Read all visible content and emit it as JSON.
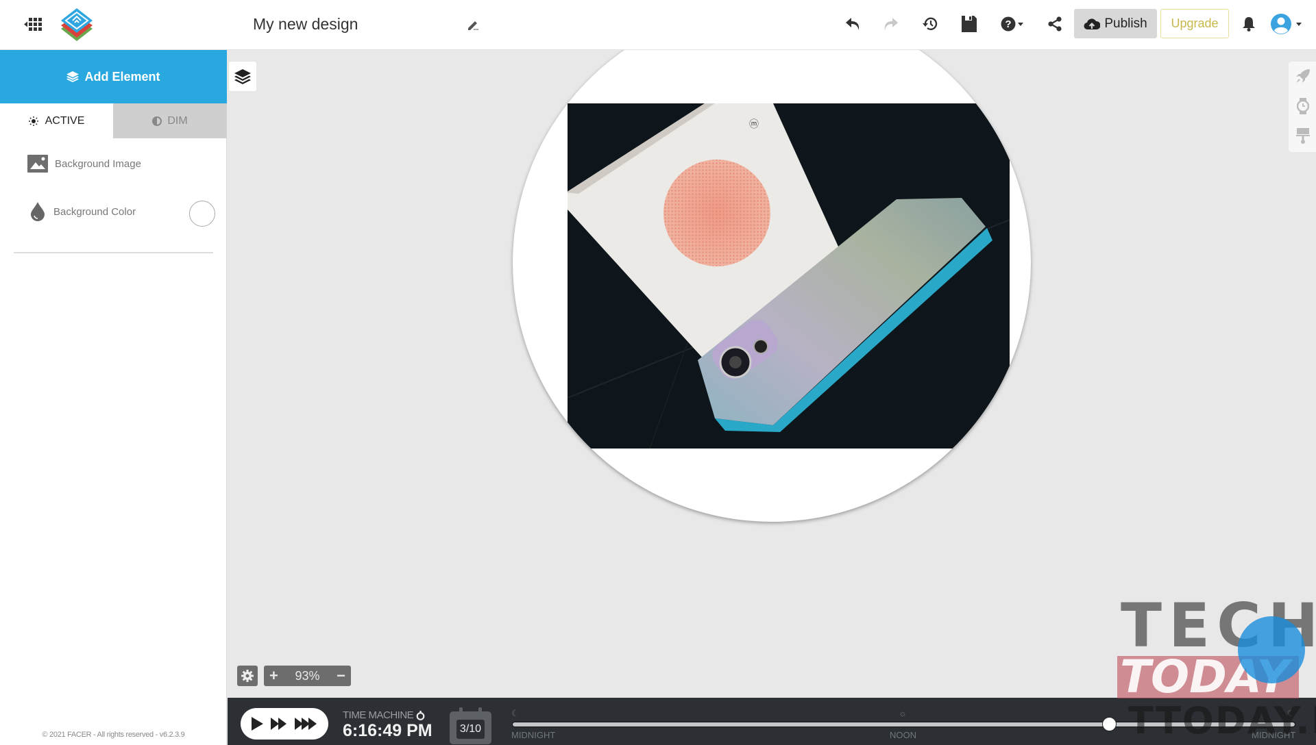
{
  "header": {
    "title": "My new design",
    "publish_label": "Publish",
    "upgrade_label": "Upgrade",
    "icons": [
      "apps-grid-icon",
      "facer-logo",
      "edit-pencil-icon",
      "undo-icon",
      "redo-icon",
      "history-icon",
      "save-icon",
      "help-icon",
      "share-icon",
      "cloud-upload-icon",
      "bell-icon",
      "user-avatar-icon"
    ]
  },
  "sidebar": {
    "add_element_label": "Add Element",
    "tabs": [
      {
        "label": "ACTIVE",
        "icon": "sun-icon",
        "selected": true
      },
      {
        "label": "DIM",
        "icon": "half-circle-icon",
        "selected": false
      }
    ],
    "items": [
      {
        "label": "Background Image",
        "icon": "image-icon"
      },
      {
        "label": "Background Color",
        "icon": "droplet-icon",
        "value": "#ffffff"
      }
    ],
    "copyright": "© 2021 FACER - All rights reserved - v6.2.3.9"
  },
  "canvas": {
    "zoom_level": "93%",
    "zoom_in_label": "+",
    "zoom_out_label": "−",
    "right_rail_icons": [
      "rocket-icon",
      "watch-icon",
      "paint-roller-icon"
    ]
  },
  "timeline": {
    "time_machine_label": "TIME MACHINE",
    "time": "6:16:49 PM",
    "date": "3/10",
    "labels": {
      "start": "MIDNIGHT",
      "middle": "NOON",
      "end": "MIDNIGHT"
    },
    "progress_fraction": 0.762
  },
  "watermark": {
    "line1": "TECH",
    "line2": "TODAY",
    "line3": "TTODAY.IT"
  },
  "colors": {
    "accent": "#29a8e0",
    "upgrade": "#c6b84a",
    "bottom_bar": "#2c2f33",
    "avatar": "#3aa3e0"
  }
}
